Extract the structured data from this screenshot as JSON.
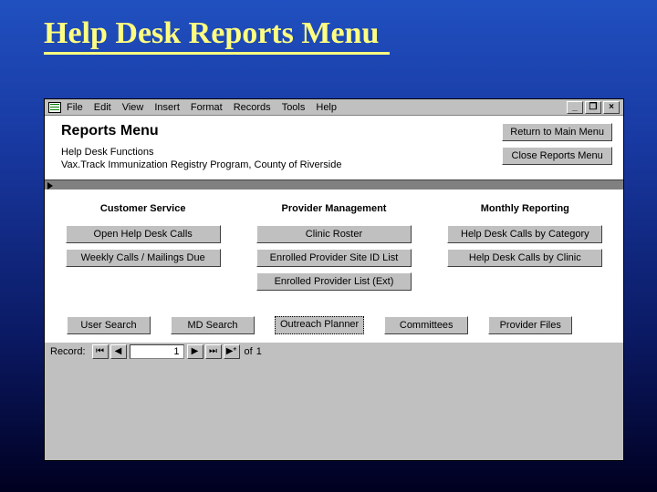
{
  "slide_title": "Help Desk Reports Menu",
  "menubar": [
    "File",
    "Edit",
    "View",
    "Insert",
    "Format",
    "Records",
    "Tools",
    "Help"
  ],
  "header": {
    "title": "Reports Menu",
    "sub1": "Help Desk Functions",
    "sub2": "Vax.Track Immunization Registry Program, County of Riverside",
    "btn_return": "Return to Main Menu",
    "btn_close": "Close Reports Menu"
  },
  "cols": {
    "c1": {
      "head": "Customer Service",
      "b1": "Open Help Desk Calls",
      "b2": "Weekly Calls / Mailings Due"
    },
    "c2": {
      "head": "Provider Management",
      "b1": "Clinic Roster",
      "b2": "Enrolled Provider Site ID List",
      "b3": "Enrolled Provider List (Ext)"
    },
    "c3": {
      "head": "Monthly Reporting",
      "b1": "Help Desk Calls by Category",
      "b2": "Help Desk Calls by Clinic"
    }
  },
  "footer": {
    "b1": "User Search",
    "b2": "MD Search",
    "b3": "Outreach Planner",
    "b4": "Committees",
    "b5": "Provider Files"
  },
  "record": {
    "label": "Record:",
    "current": "1",
    "of": "of",
    "total": "1"
  }
}
